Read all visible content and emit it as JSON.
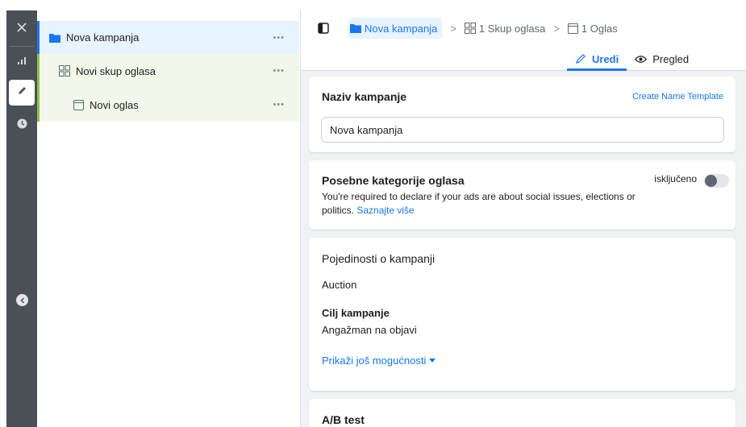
{
  "rail": {
    "items": [
      {
        "name": "close",
        "icon": "close-icon"
      },
      {
        "name": "reporting",
        "icon": "bar-chart-icon"
      },
      {
        "name": "edit",
        "icon": "pencil-icon",
        "active": true
      },
      {
        "name": "history",
        "icon": "clock-icon"
      }
    ],
    "collapse_icon": "chevron-left-icon"
  },
  "tree": {
    "campaign": {
      "label": "Nova kampanja",
      "icon": "folder-icon",
      "more": "•••"
    },
    "adset": {
      "label": "Novi skup oglasa",
      "icon": "grid-icon",
      "more": "•••"
    },
    "ad": {
      "label": "Novi oglas",
      "icon": "ad-icon",
      "more": "•••"
    }
  },
  "header": {
    "breadcrumb": [
      {
        "label": "Nova kampanja",
        "icon": "folder-icon"
      },
      {
        "label": "1 Skup oglasa",
        "icon": "grid-icon"
      },
      {
        "label": "1 Oglas",
        "icon": "ad-icon"
      }
    ],
    "separator": ">",
    "tabs": [
      {
        "label": "Uredi",
        "icon": "pencil-icon",
        "active": true
      },
      {
        "label": "Pregled",
        "icon": "eye-icon",
        "active": false
      }
    ]
  },
  "name_card": {
    "title": "Naziv kampanje",
    "template_link": "Create Name Template",
    "input_value": "Nova kampanja"
  },
  "special_card": {
    "title": "Posebne kategorije oglasa",
    "description": "You're required to declare if your ads are about social issues, elections or politics.",
    "learn_more": "Saznajte više",
    "toggle_label": "isključeno",
    "toggle_on": false
  },
  "details_card": {
    "title": "Pojedinosti o kampanji",
    "buying_type": "Auction",
    "objective_label": "Cilj kampanje",
    "objective_value": "Angažman na objavi",
    "more_options": "Prikaži još mogućnosti"
  },
  "ab_card": {
    "title": "A/B test"
  },
  "colors": {
    "accent": "#1877f2",
    "rail_bg": "#4b4f56",
    "campaign_row_bg": "#e7f3ff",
    "adset_row_bg": "#f1f8e9",
    "adset_border": "#8bc34a"
  }
}
